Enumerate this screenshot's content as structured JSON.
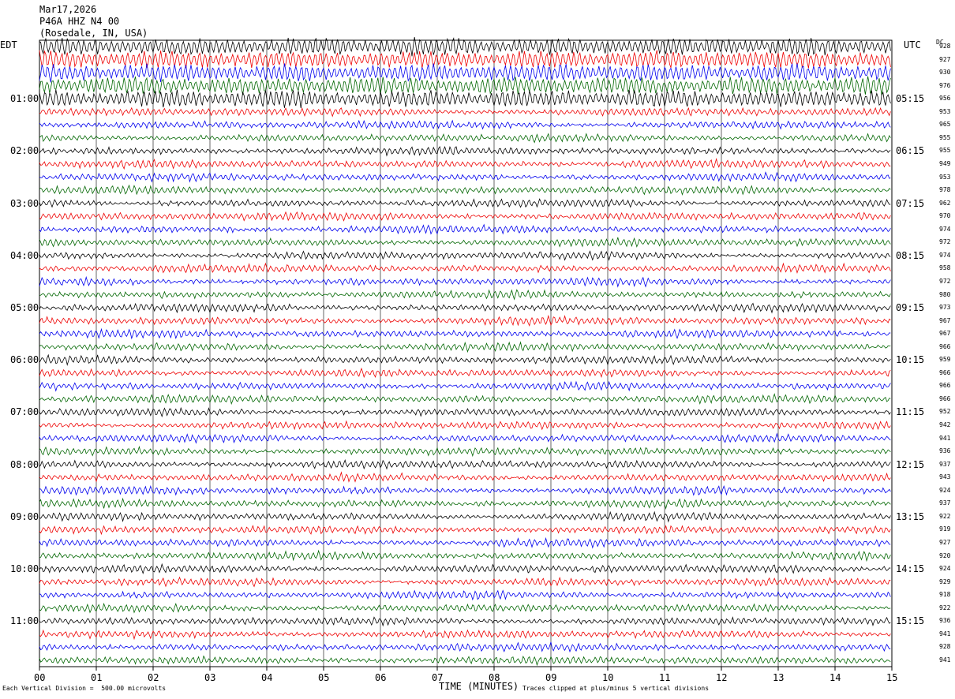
{
  "header": {
    "date": "Mar17,2026",
    "station": "P46A HHZ N4 00",
    "location": "(Rosedale, IN, USA)"
  },
  "left_tz": "EDT",
  "right_tz": "UTC",
  "dc_label": "DC",
  "footer": {
    "scale_note": "Each Vertical Division =  500.00 microvolts",
    "clip_note": "Traces clipped at plus/minus 5 vertical divisions"
  },
  "chart_data": {
    "type": "line",
    "title": "",
    "xlabel": "TIME (MINUTES)",
    "x_ticks": [
      "00",
      "01",
      "02",
      "03",
      "04",
      "05",
      "06",
      "07",
      "08",
      "09",
      "10",
      "11",
      "12",
      "13",
      "14",
      "15"
    ],
    "xlim": [
      0,
      15
    ],
    "trace_colors": [
      "#000000",
      "#ee0000",
      "#0000ee",
      "#006600"
    ],
    "left_hour_labels": [
      "01:00",
      "02:00",
      "03:00",
      "04:00",
      "05:00",
      "06:00",
      "07:00",
      "08:00",
      "09:00",
      "10:00",
      "11:00"
    ],
    "right_hour_labels": [
      "05:15",
      "06:15",
      "07:15",
      "08:15",
      "09:15",
      "10:15",
      "11:15",
      "12:15",
      "13:15",
      "14:15",
      "15:15"
    ],
    "dc_offsets": [
      928,
      927,
      930,
      976,
      956,
      953,
      965,
      955,
      955,
      949,
      953,
      978,
      962,
      970,
      974,
      972,
      974,
      958,
      972,
      980,
      973,
      967,
      967,
      966,
      959,
      966,
      966,
      966,
      952,
      942,
      941,
      936,
      937,
      943,
      924,
      937,
      922,
      919,
      927,
      920,
      924,
      929,
      918,
      922,
      936,
      941,
      928,
      941
    ],
    "notes": [
      "Traces clipped at plus/minus 5 vertical divisions"
    ]
  }
}
